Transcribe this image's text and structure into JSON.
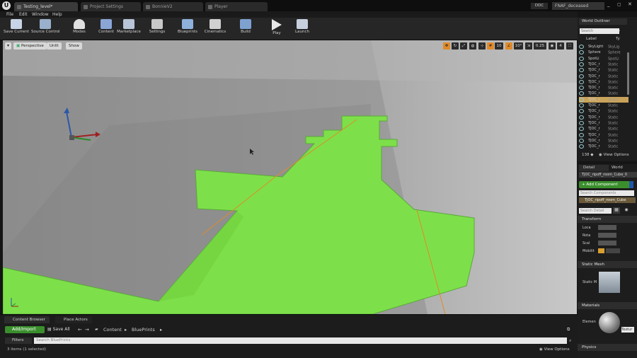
{
  "window": {
    "tabs": [
      {
        "label": "Testing_level*",
        "active": true
      },
      {
        "label": "Project Settings",
        "active": false
      },
      {
        "label": "BonnieV2",
        "active": false
      },
      {
        "label": "Player",
        "active": false
      }
    ],
    "ddc_label": "DDC",
    "project_name": "FNAF_deceased"
  },
  "menu": {
    "items": [
      "File",
      "Edit",
      "Window",
      "Help"
    ]
  },
  "toolbar": {
    "buttons": [
      {
        "label": "Save Current",
        "icon": "save-icon"
      },
      {
        "label": "Source Control",
        "icon": "source-control-icon"
      },
      {
        "label": "Modes",
        "icon": "modes-icon"
      },
      {
        "label": "Content",
        "icon": "content-icon"
      },
      {
        "label": "Marketplace",
        "icon": "marketplace-icon"
      },
      {
        "label": "Settings",
        "icon": "settings-icon"
      },
      {
        "label": "Blueprints",
        "icon": "blueprints-icon"
      },
      {
        "label": "Cinematics",
        "icon": "cinematics-icon"
      },
      {
        "label": "Build",
        "icon": "build-icon"
      },
      {
        "label": "Play",
        "icon": "play-icon"
      },
      {
        "label": "Launch",
        "icon": "launch-icon"
      }
    ]
  },
  "viewport": {
    "perspective_label": "Perspective",
    "unlit_label": "Unlit",
    "show_label": "Show",
    "grid_snap": "10",
    "rotation_snap": "10°",
    "scale_snap": "0.25",
    "camera_speed": "4",
    "floor_color": "#7de04a"
  },
  "outliner": {
    "title": "World Outliner",
    "search_placeholder": "Search",
    "col_label": "Label",
    "col_type": "Ty",
    "rows": [
      {
        "label": "SkyLight",
        "type": "SkyLig",
        "selected": false
      },
      {
        "label": "Sphere",
        "type": "Sphere",
        "selected": false
      },
      {
        "label": "SpotLi",
        "type": "SpotLi",
        "selected": false
      },
      {
        "label": "TJOC_r",
        "type": "Static",
        "selected": false
      },
      {
        "label": "TJOC_r",
        "type": "Static",
        "selected": false
      },
      {
        "label": "TJOC_r",
        "type": "Static",
        "selected": false
      },
      {
        "label": "TJOC_r",
        "type": "Static",
        "selected": false
      },
      {
        "label": "TJOC_r",
        "type": "Static",
        "selected": false
      },
      {
        "label": "TJOC_r",
        "type": "Static",
        "selected": false
      },
      {
        "label": "TJOC_r",
        "type": "Static",
        "selected": true
      },
      {
        "label": "TJOC_r",
        "type": "Static",
        "selected": false
      },
      {
        "label": "TJOC_r",
        "type": "Static",
        "selected": false
      },
      {
        "label": "TJOC_r",
        "type": "Static",
        "selected": false
      },
      {
        "label": "TJOC_r",
        "type": "Static",
        "selected": false
      },
      {
        "label": "TJOC_r",
        "type": "Static",
        "selected": false
      },
      {
        "label": "TJOC_r",
        "type": "Static",
        "selected": false
      },
      {
        "label": "TJOC_r",
        "type": "Static",
        "selected": false
      },
      {
        "label": "TJOC_r",
        "type": "Static",
        "selected": false
      }
    ],
    "count": "138 ◆",
    "view_options": "View Options"
  },
  "details": {
    "tab_details": "Detail",
    "tab_world": "World",
    "object_name": "TJOC_ripoff_room_Cube_0",
    "add_component": "+ Add Component",
    "search_components": "Search Components",
    "component_name": "TJOC_ripoff_room_Cube",
    "search_details": "Search Detail",
    "transform": "Transform",
    "location": "Loca",
    "rotation": "Rota",
    "scale": "Scal",
    "mobility": "Mobilit",
    "static_mesh_section": "Static Mesh",
    "static_mesh_label": "Static M",
    "materials_section": "Materials",
    "element_label": "Elemen",
    "texture_label": "Textur",
    "physics_section": "Physics"
  },
  "content_browser": {
    "tab_label": "Content Browser",
    "place_actors": "Place Actors",
    "add_import": "Add/Import",
    "save_all": "Save All",
    "path": [
      "Content",
      "BluePrints"
    ],
    "filters": "Filters",
    "search_placeholder": "Search BluePrints",
    "status": "3 items (1 selected)",
    "view_options": "View Options"
  }
}
